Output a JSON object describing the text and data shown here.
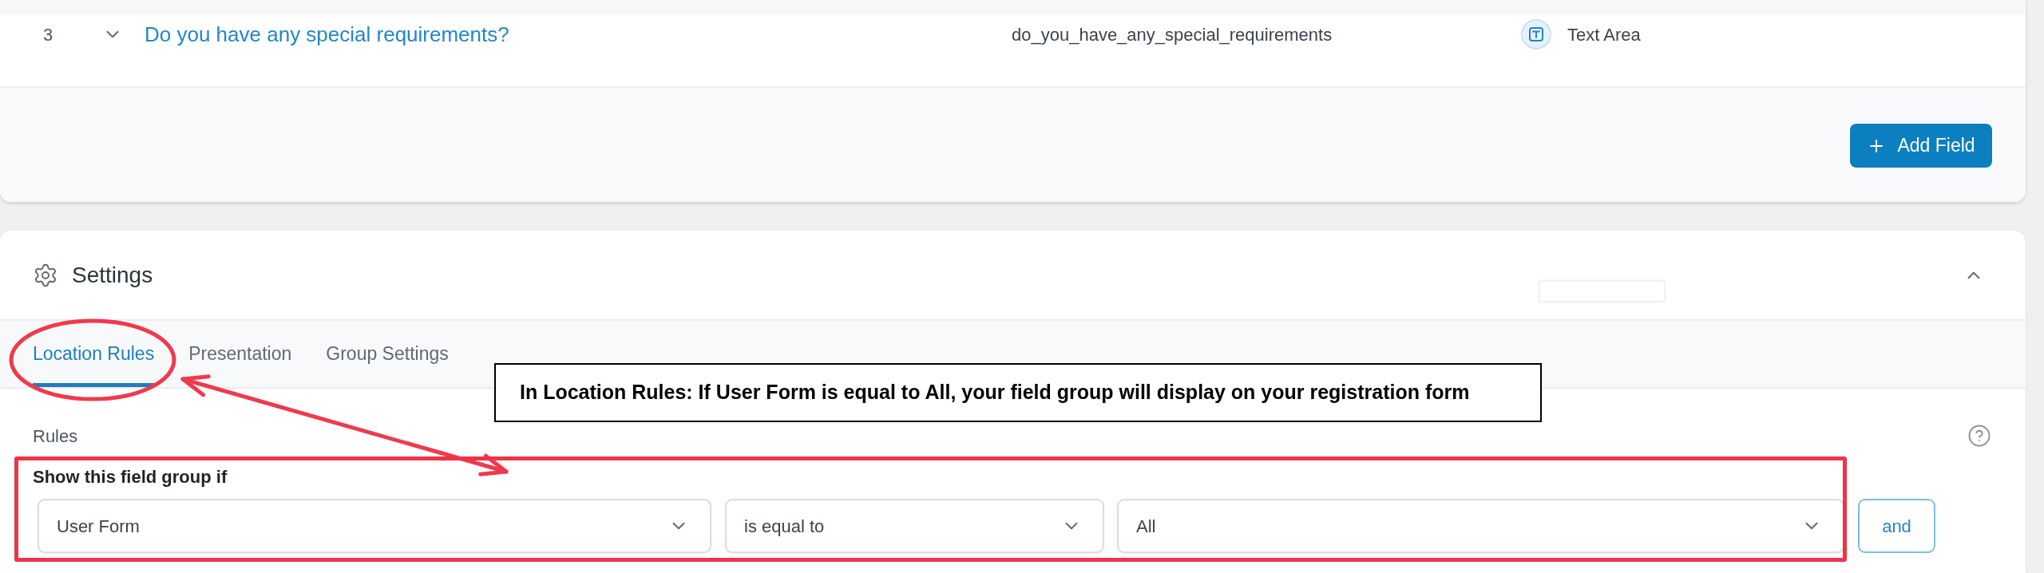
{
  "fields_table": {
    "rows": [
      {
        "number": "3",
        "expanded": false,
        "label": "Do you have any special requirements?",
        "field_name": "do_you_have_any_special_requirements",
        "type": "Text Area"
      }
    ]
  },
  "add_field_button": "Add Field",
  "settings": {
    "title": "Settings",
    "expanded": true,
    "tabs": [
      {
        "label": "Location Rules",
        "selected": true
      },
      {
        "label": "Presentation",
        "selected": false
      },
      {
        "label": "Group Settings",
        "selected": false
      }
    ],
    "rules": {
      "heading": "Rules",
      "group_label": "Show this field group if",
      "conditions": [
        {
          "field": "User Form",
          "operator": "is equal to",
          "value": "All"
        }
      ],
      "and_button": "and"
    }
  },
  "annotation": {
    "callout": "In Location Rules: If User Form is equal to All, your field group will display on your registration form"
  }
}
